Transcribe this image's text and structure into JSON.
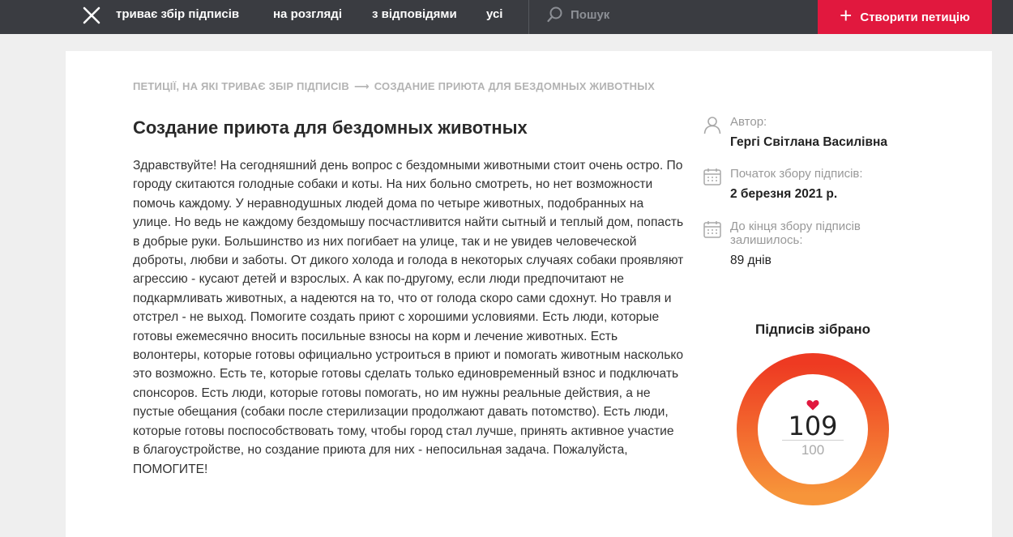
{
  "nav": {
    "items": [
      "триває збір підписів",
      "на розгляді",
      "з відповідями",
      "усі"
    ],
    "search_placeholder": "Пошук",
    "create_label": "Створити петицію"
  },
  "breadcrumb": {
    "parent": "ПЕТИЦІЇ, НА ЯКІ ТРИВАЄ ЗБІР ПІДПИСІВ",
    "separator": "⟶",
    "current": "СОЗДАНИЕ ПРИЮТА ДЛЯ БЕЗДОМНЫХ ЖИВОТНЫХ"
  },
  "petition": {
    "title": "Создание приюта для бездомных животных",
    "body": "Здравствуйте! На сегодняшний день вопрос с бездомными животными стоит очень остро. По городу скитаются голодные собаки и коты. На них больно смотреть, но нет возможности помочь каждому. У неравнодушных людей дома по четыре животных, подобранных на улице. Но ведь не каждому бездомышу посчастливится найти сытный и теплый дом, попасть в добрые руки. Большинство из них погибает на улице, так и не увидев человеческой доброты, любви и заботы. От дикого холода и голода в некоторых случаях собаки проявляют агрессию - кусают детей и взрослых. А как по-другому, если люди предпочитают не подкармливать животных, а надеются на то, что от голода скоро сами сдохнут. Но травля и отстрел - не выход. Помогите создать приют с хорошими условиями. Есть люди, которые готовы ежемесячно вносить посильные взносы на корм и лечение животных. Есть волонтеры, которые готовы официально устроиться в приют и помогать животным насколько это возможно. Есть те, которые готовы сделать только единовременный взнос и подключать спонсоров. Есть люди, которые готовы помогать, но им нужны реальные действия, а не пустые обещания (собаки после стерилизации продолжают давать потомство). Есть люди, которые готовы поспособствовать тому, чтобы город стал лучше, принять активное участие в благоустройстве, но создание приюта для них - непосильная задача. Пожалуйста, ПОМОГИТЕ!"
  },
  "sidebar": {
    "author_label": "Автор:",
    "author_value": "Гергі Світлана Василівна",
    "start_label": "Початок збору підписів:",
    "start_value": "2 березня 2021 р.",
    "remaining_label": "До кінця збору підписів залишилось:",
    "remaining_value": "89 днів",
    "signatures_heading": "Підписів зібрано",
    "signatures_count": "109",
    "signatures_target": "100",
    "progress_fraction": 1.0
  },
  "colors": {
    "topbar": "#3a3c41",
    "accent": "#e1183e",
    "ring_start": "#f7953a",
    "ring_end": "#ee3a22",
    "heart": "#e1183e"
  }
}
